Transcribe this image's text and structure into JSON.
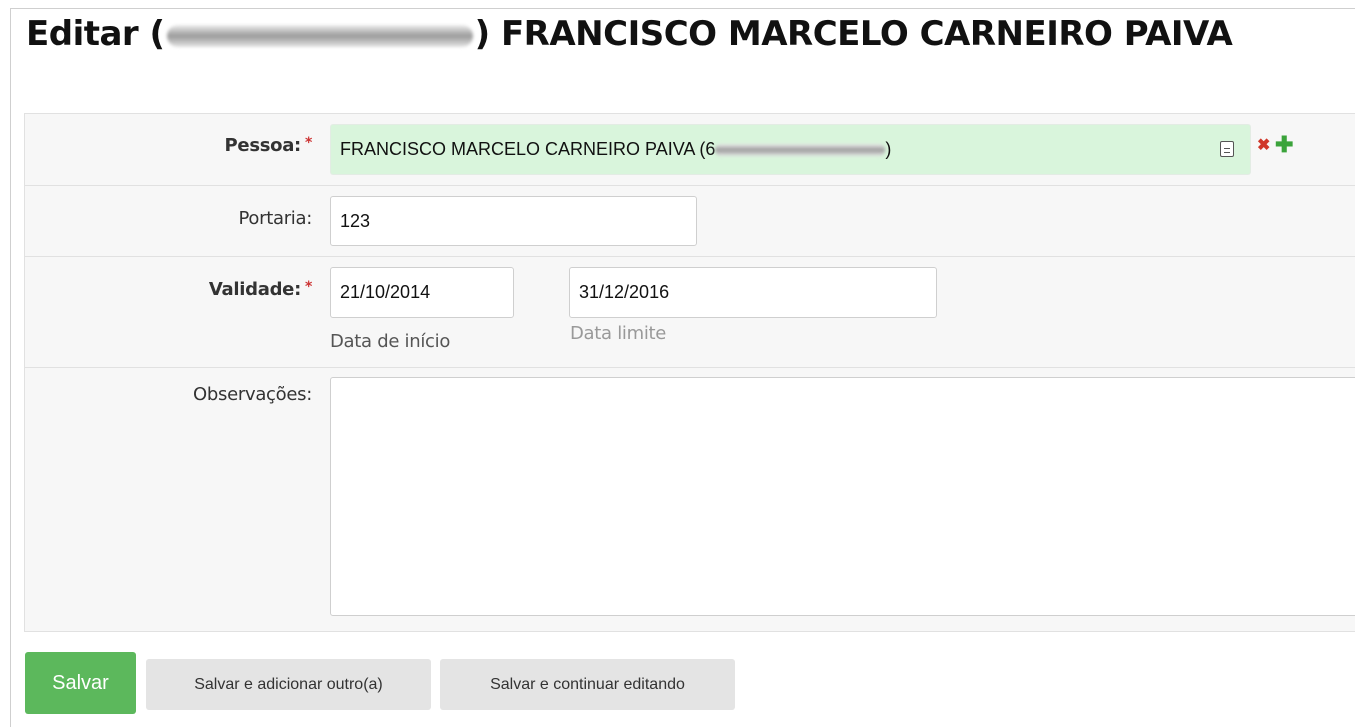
{
  "header": {
    "title_prefix": "Editar (",
    "title_suffix": ") FRANCISCO MARCELO CARNEIRO PAIVA"
  },
  "form": {
    "pessoa": {
      "label": "Pessoa:",
      "required_mark": "*",
      "value": "FRANCISCO MARCELO CARNEIRO PAIVA (6",
      "value_end": ")",
      "icons": [
        "id-card-icon",
        "delete-icon",
        "add-icon"
      ],
      "icon_colors": {
        "delete": "#d0372a",
        "add": "#3ba33b"
      }
    },
    "portaria": {
      "label": "Portaria:",
      "value": "123"
    },
    "validade": {
      "label": "Validade:",
      "required_mark": "*",
      "start_value": "21/10/2014",
      "start_help": "Data de início",
      "end_value": "31/12/2016",
      "end_help": "Data limite"
    },
    "observacoes": {
      "label": "Observações:",
      "value": ""
    }
  },
  "actions": {
    "save": "Salvar",
    "save_add_another": "Salvar e adicionar outro(a)",
    "save_continue": "Salvar e continuar editando",
    "save_color": "#5cb85c"
  }
}
